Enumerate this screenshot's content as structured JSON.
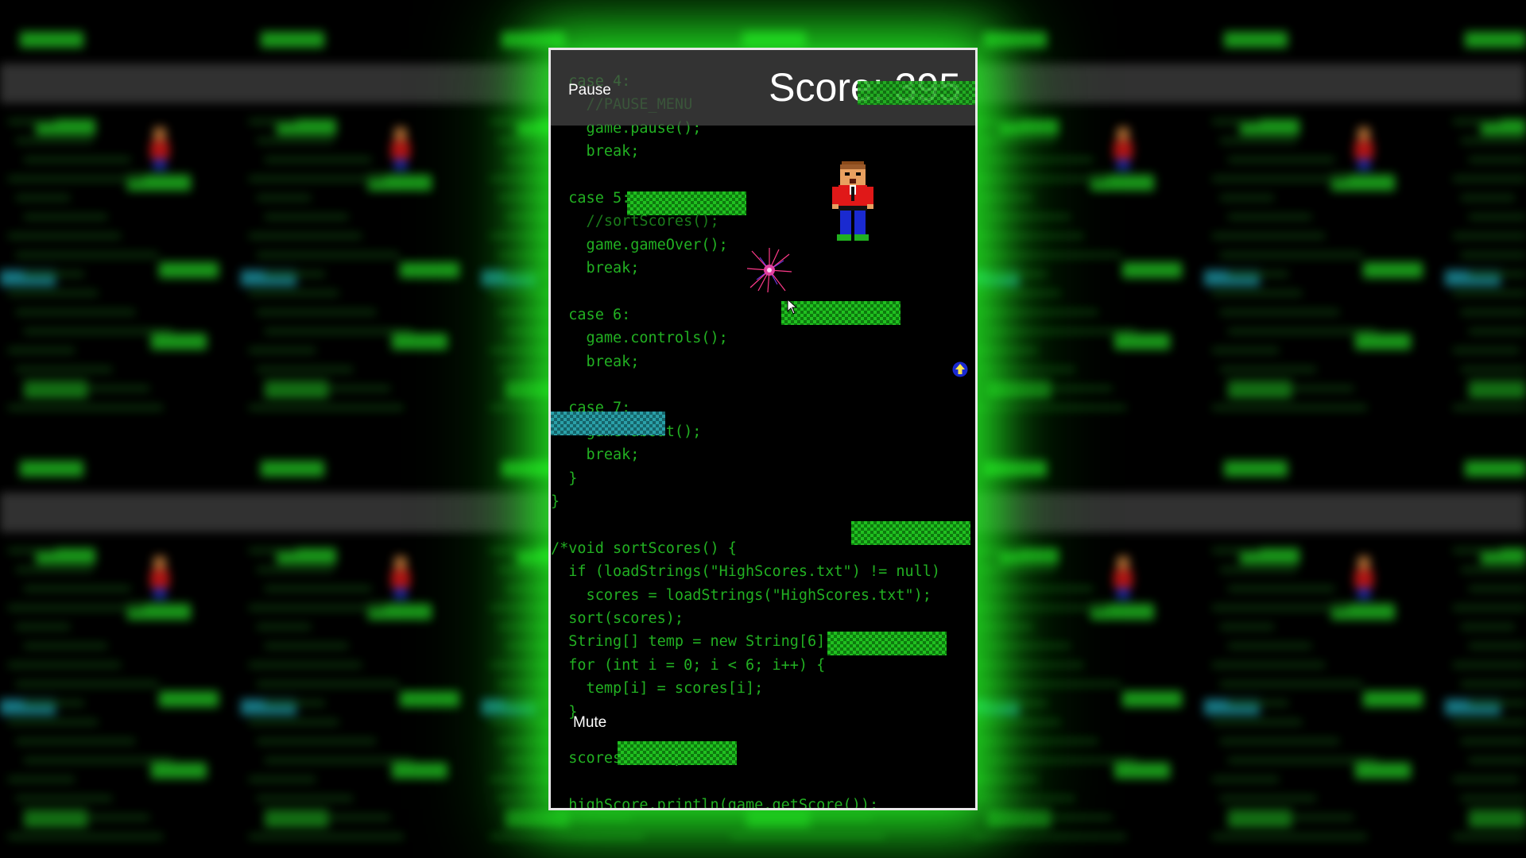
{
  "hud": {
    "pause_label": "Pause",
    "score_text": "Score: 395",
    "mute_label": "Mute"
  },
  "code_lines": [
    {
      "text": "case 4:",
      "indent": 1
    },
    {
      "text": "//PAUSE_MENU",
      "indent": 2,
      "comment": true
    },
    {
      "text": "game.pause();",
      "indent": 2
    },
    {
      "text": "break;",
      "indent": 2
    },
    {
      "text": "",
      "indent": 0
    },
    {
      "text": "case 5:",
      "indent": 1
    },
    {
      "text": "//sortScores();",
      "indent": 2,
      "comment": true
    },
    {
      "text": "game.gameOver();",
      "indent": 2
    },
    {
      "text": "break;",
      "indent": 2
    },
    {
      "text": "",
      "indent": 0
    },
    {
      "text": "case 6:",
      "indent": 1
    },
    {
      "text": "game.controls();",
      "indent": 2
    },
    {
      "text": "break;",
      "indent": 2
    },
    {
      "text": "",
      "indent": 0
    },
    {
      "text": "case 7:",
      "indent": 1
    },
    {
      "text": "game.about();",
      "indent": 2
    },
    {
      "text": "break;",
      "indent": 2
    },
    {
      "text": "}",
      "indent": 1
    },
    {
      "text": "}",
      "indent": 0
    },
    {
      "text": "",
      "indent": 0
    },
    {
      "text": "/*void sortScores() {",
      "indent": 0
    },
    {
      "text": "if (loadStrings(\"HighScores.txt\") != null)",
      "indent": 1
    },
    {
      "text": "scores = loadStrings(\"HighScores.txt\");",
      "indent": 2
    },
    {
      "text": "sort(scores);",
      "indent": 1
    },
    {
      "text": "String[] temp = new String[6];",
      "indent": 1
    },
    {
      "text": "for (int i = 0; i < 6; i++) {",
      "indent": 1
    },
    {
      "text": "temp[i] = scores[i];",
      "indent": 2
    },
    {
      "text": "}",
      "indent": 1
    },
    {
      "text": "",
      "indent": 0
    },
    {
      "text": "scores = temp;",
      "indent": 1
    },
    {
      "text": "",
      "indent": 0
    },
    {
      "text": "highScore.println(game.getScore());",
      "indent": 1
    }
  ],
  "colors": {
    "platform_green": "#20c020",
    "platform_cyan": "#2aa0a8",
    "code_text": "#22b022",
    "glow": "#28ff28"
  },
  "icons": {
    "player": "boy-character-icon",
    "enemy": "spark-burst-icon",
    "powerup": "up-arrow-powerup-icon",
    "cursor": "mouse-pointer-icon"
  }
}
